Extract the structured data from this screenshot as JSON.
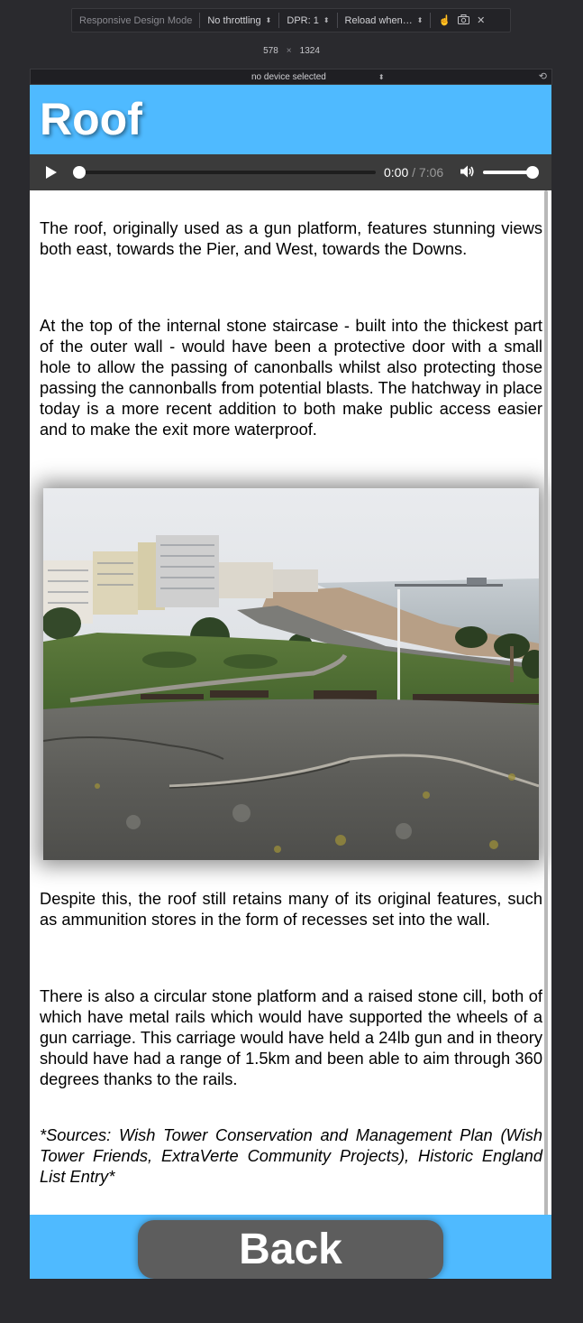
{
  "devtools": {
    "mode_label": "Responsive Design Mode",
    "throttling": "No throttling",
    "dpr": "DPR: 1",
    "reload": "Reload when…",
    "width": "578",
    "times": "×",
    "height": "1324",
    "device": "no device selected"
  },
  "page": {
    "title": "Roof",
    "audio": {
      "current_time": "0:00",
      "total_time": "/ 7:06",
      "progress": 0,
      "volume": 1.0
    },
    "paragraphs": {
      "p1": "The roof, originally used as a gun platform, features stunning views both east, towards the Pier, and West, towards the Downs.",
      "p2": "At the top of the internal stone staircase - built into the thickest part of the outer wall - would have been a protective door with a small hole to allow the passing of canonballs whilst also protecting those passing the cannonballs from potential blasts. The hatchway in place today is a more recent addition to both make public access easier and to make the exit more waterproof.",
      "p3": "Despite this, the roof still retains many of its original features, such as ammunition stores in the form of recesses set into the wall.",
      "p4": "There is also a circular stone platform and a raised stone cill, both of which have metal rails which would have supported the wheels of a gun carriage. This carriage would have held a 24lb gun and in theory should have had a range of 1.5km and been able to aim through 360 degrees thanks to the rails.",
      "sources": "*Sources: Wish Tower Conservation and Management Plan (Wish Tower Friends, ExtraVerte Community Projects), Historic England List Entry*"
    },
    "back_label": "Back"
  },
  "colors": {
    "header_bg": "#4fbaff",
    "audio_bg": "#3b3b3b",
    "back_button_bg": "#5d5d5d"
  }
}
